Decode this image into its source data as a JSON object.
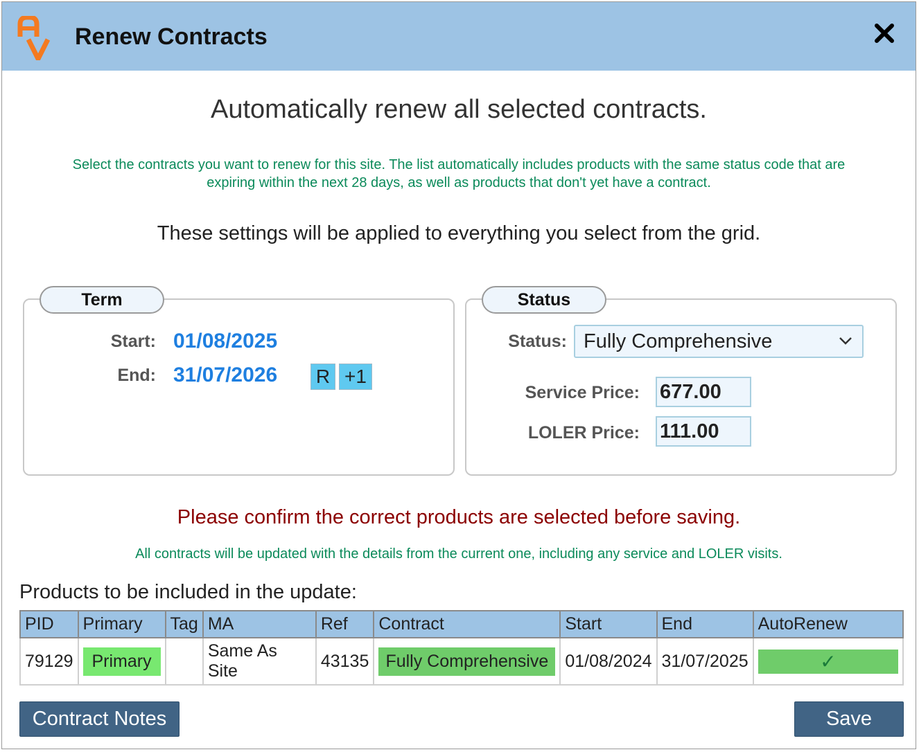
{
  "window": {
    "title": "Renew Contracts"
  },
  "texts": {
    "main_heading": "Automatically renew all selected contracts.",
    "info_line1": "Select the contracts you want to renew for this site. The list automatically includes products with the same status code that are",
    "info_line2": "expiring within the next 28 days, as well as products that don't yet have a contract.",
    "settings_heading": "These settings will be applied to everything you select from the grid.",
    "confirm_heading": "Please confirm the correct products are selected before saving.",
    "note": "All contracts will be updated with the details from the current one, including any service and LOLER visits.",
    "products_label": "Products to be included in the update:"
  },
  "term": {
    "legend": "Term",
    "start_label": "Start:",
    "start_value": "01/08/2025",
    "end_label": "End:",
    "end_value": "31/07/2026",
    "reset_button": "R",
    "plus_button": "+1"
  },
  "status_panel": {
    "legend": "Status",
    "status_label": "Status:",
    "status_value": "Fully Comprehensive",
    "service_label": "Service Price:",
    "service_value": "677.00",
    "loler_label": "LOLER Price:",
    "loler_value": "111.00"
  },
  "grid": {
    "columns": [
      "PID",
      "Primary",
      "Tag",
      "MA",
      "Ref",
      "Contract",
      "Start",
      "End",
      "AutoRenew"
    ],
    "rows": [
      {
        "pid": "79129",
        "primary": "Primary",
        "tag": "",
        "ma": "Same As Site",
        "ref": "43135",
        "contract": "Fully Comprehensive",
        "start": "01/08/2024",
        "end": "31/07/2025",
        "autorenew": "✓"
      }
    ]
  },
  "buttons": {
    "notes": "Contract Notes",
    "save": "Save"
  },
  "colors": {
    "titlebar": "#9dc3e4",
    "accent_date": "#1e7fe0",
    "info_green": "#0b8a5a",
    "warning_red": "#8b0000",
    "button": "#416485",
    "pill_green": "#78e870",
    "logo_orange": "#f47a20"
  }
}
